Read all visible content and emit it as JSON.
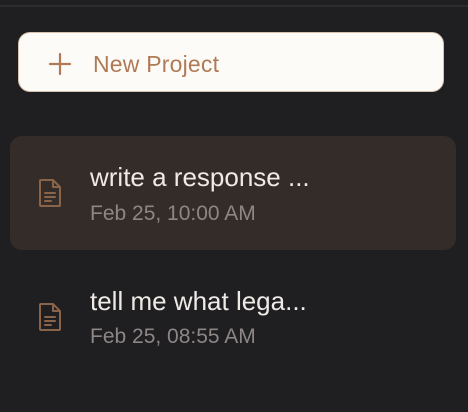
{
  "new_project": {
    "label": "New Project",
    "icon": "plus-icon"
  },
  "projects": [
    {
      "title": "write a response ...",
      "timestamp": "Feb 25, 10:00 AM",
      "icon": "document-icon",
      "active": true
    },
    {
      "title": "tell me what lega...",
      "timestamp": "Feb 25, 08:55 AM",
      "icon": "document-icon",
      "active": false
    }
  ],
  "colors": {
    "background": "#1f1e21",
    "button_bg": "#fdfbf8",
    "accent": "#b07a55",
    "active_item_bg": "#342c29",
    "title_text": "#eeeae6",
    "muted_text": "#8c8785",
    "doc_icon": "#8a6449"
  }
}
